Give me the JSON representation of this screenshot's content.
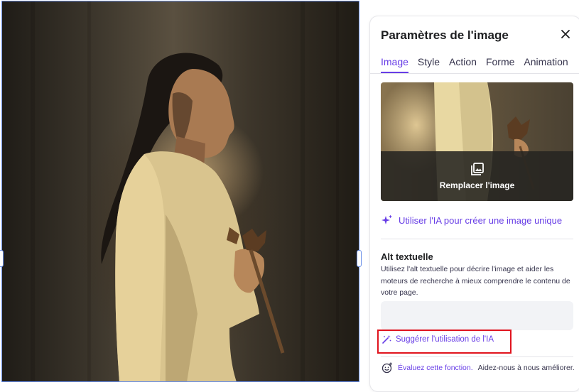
{
  "panel": {
    "title": "Paramètres de l'image",
    "tabs": [
      {
        "label": "Image",
        "active": true
      },
      {
        "label": "Style",
        "active": false
      },
      {
        "label": "Action",
        "active": false
      },
      {
        "label": "Forme",
        "active": false
      },
      {
        "label": "Animation",
        "active": false
      }
    ],
    "replace_label": "Remplacer l'image",
    "ai_create_label": "Utiliser l'IA pour créer une image unique",
    "alt": {
      "title": "Alt textuelle",
      "description": "Utilisez l'alt textuelle pour décrire l'image et aider les moteurs de recherche à mieux comprendre le contenu de votre page.",
      "value": ""
    },
    "suggest_label": "Suggérer l'utilisation de l'IA",
    "feedback": {
      "link_label": "Évaluez cette fonction.",
      "text": "Aidez-nous à nous améliorer."
    }
  },
  "colors": {
    "accent": "#673de6",
    "highlight_border": "#e0141e",
    "selection_border": "#6a8fe8"
  },
  "icons": [
    "close-icon",
    "image-stack-icon",
    "sparkles-icon",
    "magic-wand-icon",
    "smiley-add-icon"
  ]
}
